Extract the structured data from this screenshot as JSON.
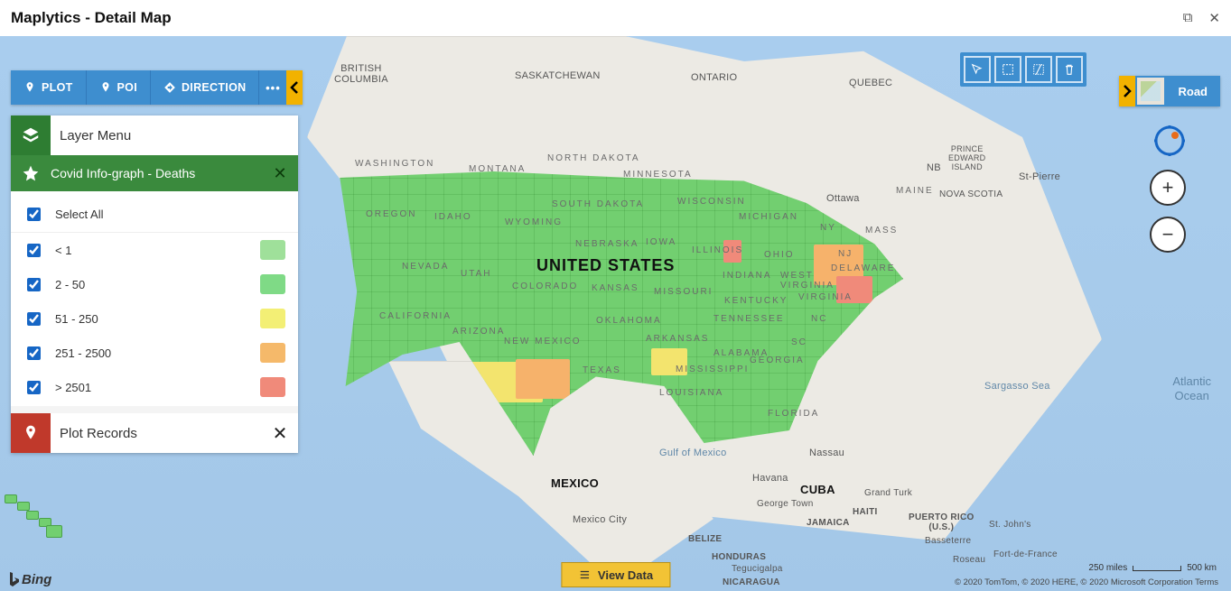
{
  "window": {
    "title": "Maplytics - Detail Map"
  },
  "toolbar": {
    "plot": "PLOT",
    "poi": "POI",
    "direction": "DIRECTION",
    "more": "•••"
  },
  "panel": {
    "layer_menu": "Layer Menu",
    "layer_title": "Covid Info-graph - Deaths",
    "select_all": "Select All",
    "items": [
      {
        "label": "< 1",
        "color": "#9fe09a",
        "checked": true
      },
      {
        "label": "2 - 50",
        "color": "#7fda86",
        "checked": true
      },
      {
        "label": "51 - 250",
        "color": "#f3ef75",
        "checked": true
      },
      {
        "label": "251 - 2500",
        "color": "#f5b96a",
        "checked": true
      },
      {
        "label": "> 2501",
        "color": "#f08a7a",
        "checked": true
      }
    ],
    "plot_records": "Plot Records"
  },
  "map": {
    "style_label": "Road",
    "labels": {
      "british_columbia": "BRITISH\nCOLUMBIA",
      "saskatchewan": "SASKATCHEWAN",
      "ontario": "ONTARIO",
      "quebec": "QUEBEC",
      "nb": "NB",
      "pei": "PRINCE\nEDWARD\nISLAND",
      "nova_scotia": "NOVA SCOTIA",
      "st_pierre": "St-Pierre",
      "ottawa": "Ottawa",
      "united_states": "UNITED STATES",
      "washington": "WASHINGTON",
      "montana": "MONTANA",
      "north_dakota": "NORTH DAKOTA",
      "minnesota": "MINNESOTA",
      "wisconsin": "WISCONSIN",
      "michigan": "MICHIGAN",
      "maine": "MAINE",
      "ohio": "OHIO",
      "ny": "NY",
      "mass": "MASS",
      "nj": "NJ",
      "delaware": "DELAWARE",
      "wv": "WEST\nVIRGINIA",
      "virginia": "VIRGINIA",
      "kentucky": "KENTUCKY",
      "tennessee": "TENNESSEE",
      "nc": "NC",
      "sc": "SC",
      "georgia": "GEORGIA",
      "alabama": "ALABAMA",
      "mississippi": "MISSISSIPPI",
      "louisiana": "LOUISIANA",
      "arkansas": "ARKANSAS",
      "oklahoma": "OKLAHOMA",
      "texas": "TEXAS",
      "new_mexico": "NEW MEXICO",
      "arizona": "ARIZONA",
      "california": "CALIFORNIA",
      "nevada": "NEVADA",
      "utah": "UTAH",
      "colorado": "COLORADO",
      "kansas": "KANSAS",
      "missouri": "MISSOURI",
      "iowa": "IOWA",
      "nebraska": "NEBRASKA",
      "south_dakota": "SOUTH DAKOTA",
      "wyoming": "WYOMING",
      "idaho": "IDAHO",
      "oregon": "OREGON",
      "indiana": "INDIANA",
      "illinois": "ILLINOIS",
      "florida": "FLORIDA",
      "mexico": "MEXICO",
      "mexico_city": "Mexico City",
      "belize": "BELIZE",
      "honduras": "HONDURAS",
      "tegucigalpa": "Tegucigalpa",
      "nicaragua": "NICARAGUA",
      "cuba": "CUBA",
      "havana": "Havana",
      "nassau": "Nassau",
      "jamaica": "JAMAICA",
      "haiti": "HAITI",
      "george_town": "George Town",
      "grand_turk": "Grand Turk",
      "puerto_rico": "PUERTO RICO\n(U.S.)",
      "st_johns": "St. John's",
      "basseterre": "Basseterre",
      "fort_de_france": "Fort-de-France",
      "roseau": "Roseau",
      "gulf": "Gulf of Mexico",
      "sargasso": "Sargasso Sea",
      "atlantic": "Atlantic\nOcean"
    },
    "view_data": "View Data",
    "bing": "Bing",
    "scale_miles": "250 miles",
    "scale_km": "500 km",
    "copyright": "© 2020 TomTom, © 2020 HERE, © 2020 Microsoft Corporation  Terms"
  }
}
